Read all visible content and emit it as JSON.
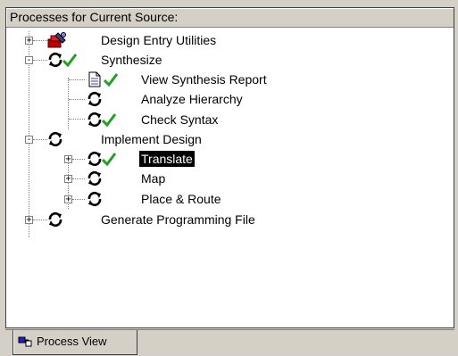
{
  "panel": {
    "title": "Processes for Current Source:"
  },
  "tree": [
    {
      "label": "Design Entry Utilities",
      "icon": "design-entry-utilities-icon",
      "status": "none",
      "expander": "+"
    },
    {
      "label": "Synthesize",
      "icon": "process-run-icon",
      "status": "check",
      "expander": "-"
    },
    {
      "label": "View Synthesis Report",
      "icon": "report-document-icon",
      "status": "check",
      "expander": ""
    },
    {
      "label": "Analyze Hierarchy",
      "icon": "process-run-icon",
      "status": "none",
      "expander": ""
    },
    {
      "label": "Check Syntax",
      "icon": "process-run-icon",
      "status": "check",
      "expander": ""
    },
    {
      "label": "Implement Design",
      "icon": "process-run-icon",
      "status": "none",
      "expander": "-"
    },
    {
      "label": "Translate",
      "icon": "process-run-icon",
      "status": "check",
      "expander": "+",
      "selected": true
    },
    {
      "label": "Map",
      "icon": "process-run-icon",
      "status": "none",
      "expander": "+"
    },
    {
      "label": "Place & Route",
      "icon": "process-run-icon",
      "status": "none",
      "expander": "+"
    },
    {
      "label": "Generate Programming File",
      "icon": "process-run-icon",
      "status": "none",
      "expander": "+"
    }
  ],
  "tabs": [
    {
      "label": "Process View",
      "icon": "process-view-icon",
      "active": true
    }
  ],
  "colors": {
    "check": "#22a022",
    "selection": "#000000",
    "window": "#d4d0c8"
  }
}
